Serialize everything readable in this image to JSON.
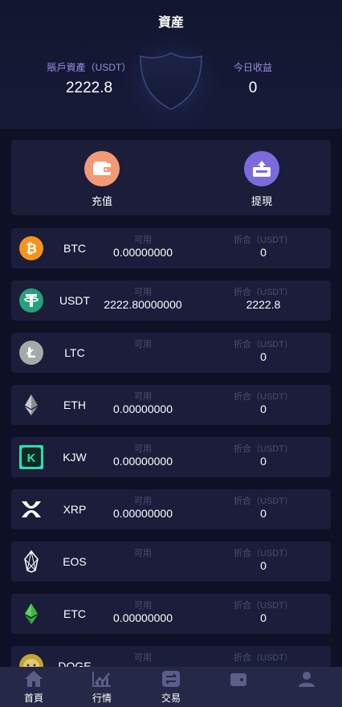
{
  "header": {
    "title": "資産",
    "account_label": "賬戶資產（USDT）",
    "account_value": "2222.8",
    "today_label": "今日收益",
    "today_value": "0"
  },
  "actions": {
    "deposit_label": "充值",
    "withdraw_label": "提現"
  },
  "columns": {
    "available_label": "可用",
    "converted_label": "折合（USDT）"
  },
  "assets": [
    {
      "symbol": "BTC",
      "available": "0.00000000",
      "converted": "0",
      "icon": "btc-icon",
      "color": "#f7931a"
    },
    {
      "symbol": "USDT",
      "available": "2222.80000000",
      "converted": "2222.8",
      "icon": "usdt-icon",
      "color": "#26a17b"
    },
    {
      "symbol": "LTC",
      "available": "",
      "converted": "0",
      "icon": "ltc-icon",
      "color": "#a6a9aa"
    },
    {
      "symbol": "ETH",
      "available": "0.00000000",
      "converted": "0",
      "icon": "eth-icon",
      "color": "#8c8c8c"
    },
    {
      "symbol": "KJW",
      "available": "0.00000000",
      "converted": "0",
      "icon": "kjw-icon",
      "color": "#28e0b0"
    },
    {
      "symbol": "XRP",
      "available": "0.00000000",
      "converted": "0",
      "icon": "xrp-icon",
      "color": "#ffffff"
    },
    {
      "symbol": "EOS",
      "available": "",
      "converted": "0",
      "icon": "eos-icon",
      "color": "#ffffff"
    },
    {
      "symbol": "ETC",
      "available": "0.00000000",
      "converted": "0",
      "icon": "etc-icon",
      "color": "#3ab83a"
    },
    {
      "symbol": "DOGE",
      "available": "",
      "converted": "",
      "icon": "doge-icon",
      "color": "#c2a633"
    }
  ],
  "nav": {
    "home": "首頁",
    "market": "行情",
    "trade": "交易",
    "assets": "",
    "mine": ""
  }
}
